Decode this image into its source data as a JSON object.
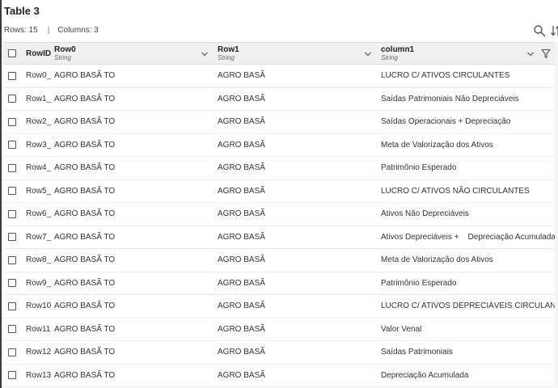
{
  "title": "Table 3",
  "meta": {
    "rows": "Rows: 15",
    "separator": "|",
    "columns": "Columns: 3"
  },
  "icons": {
    "search": "search-icon",
    "sort": "sort-icon",
    "filter": "filter-icon",
    "chevron": "chevron-down-icon"
  },
  "columns": [
    {
      "name": "RowID",
      "type": ""
    },
    {
      "name": "Row0",
      "type": "String"
    },
    {
      "name": "Row1",
      "type": "String"
    },
    {
      "name": "column1",
      "type": "String"
    }
  ],
  "rows": [
    {
      "id": "Row0_",
      "r0": "AGRO BASÃ TO",
      "r1": "AGRO BASÃ",
      "c1": "LUCRO C/ ATIVOS CIRCULANTES"
    },
    {
      "id": "Row1_",
      "r0": "AGRO BASÃ TO",
      "r1": "AGRO BASÃ",
      "c1": "Saídas Patrimoniais Não Depreciáveis"
    },
    {
      "id": "Row2_",
      "r0": "AGRO BASÃ TO",
      "r1": "AGRO BASÃ",
      "c1": "Saídas Operacionais + Depreciação"
    },
    {
      "id": "Row3_",
      "r0": "AGRO BASÃ TO",
      "r1": "AGRO BASÃ",
      "c1": "Meta de Valorização dos Ativos"
    },
    {
      "id": "Row4_",
      "r0": "AGRO BASÃ TO",
      "r1": "AGRO BASÃ",
      "c1": "Patrimônio Esperado"
    },
    {
      "id": "Row5_",
      "r0": "AGRO BASÃ TO",
      "r1": "AGRO BASÃ",
      "c1": "LUCRO C/ ATIVOS NÃO CIRCULANTES"
    },
    {
      "id": "Row6_",
      "r0": "AGRO BASÃ TO",
      "r1": "AGRO BASÃ",
      "c1": "Ativos Não Depreciáveis"
    },
    {
      "id": "Row7_",
      "r0": "AGRO BASÃ TO",
      "r1": "AGRO BASÃ",
      "c1": "Ativos Depreciáveis +    Depreciação Acumulada"
    },
    {
      "id": "Row8_",
      "r0": "AGRO BASÃ TO",
      "r1": "AGRO BASÃ",
      "c1": "Meta de Valorização dos Ativos"
    },
    {
      "id": "Row9_",
      "r0": "AGRO BASÃ TO",
      "r1": "AGRO BASÃ",
      "c1": "Patrimônio Esperado"
    },
    {
      "id": "Row10",
      "r0": "AGRO BASÃ TO",
      "r1": "AGRO BASÃ",
      "c1": "LUCRO C/ ATIVOS DEPRECIÁVEIS CIRCULANTES"
    },
    {
      "id": "Row11",
      "r0": "AGRO BASÃ TO",
      "r1": "AGRO BASÃ",
      "c1": "Valor Venal"
    },
    {
      "id": "Row12",
      "r0": "AGRO BASÃ TO",
      "r1": "AGRO BASÃ",
      "c1": "Saídas Patrimoniais"
    },
    {
      "id": "Row13",
      "r0": "AGRO BASÃ TO",
      "r1": "AGRO BASÃ",
      "c1": "Depreciação Acumulada"
    }
  ]
}
